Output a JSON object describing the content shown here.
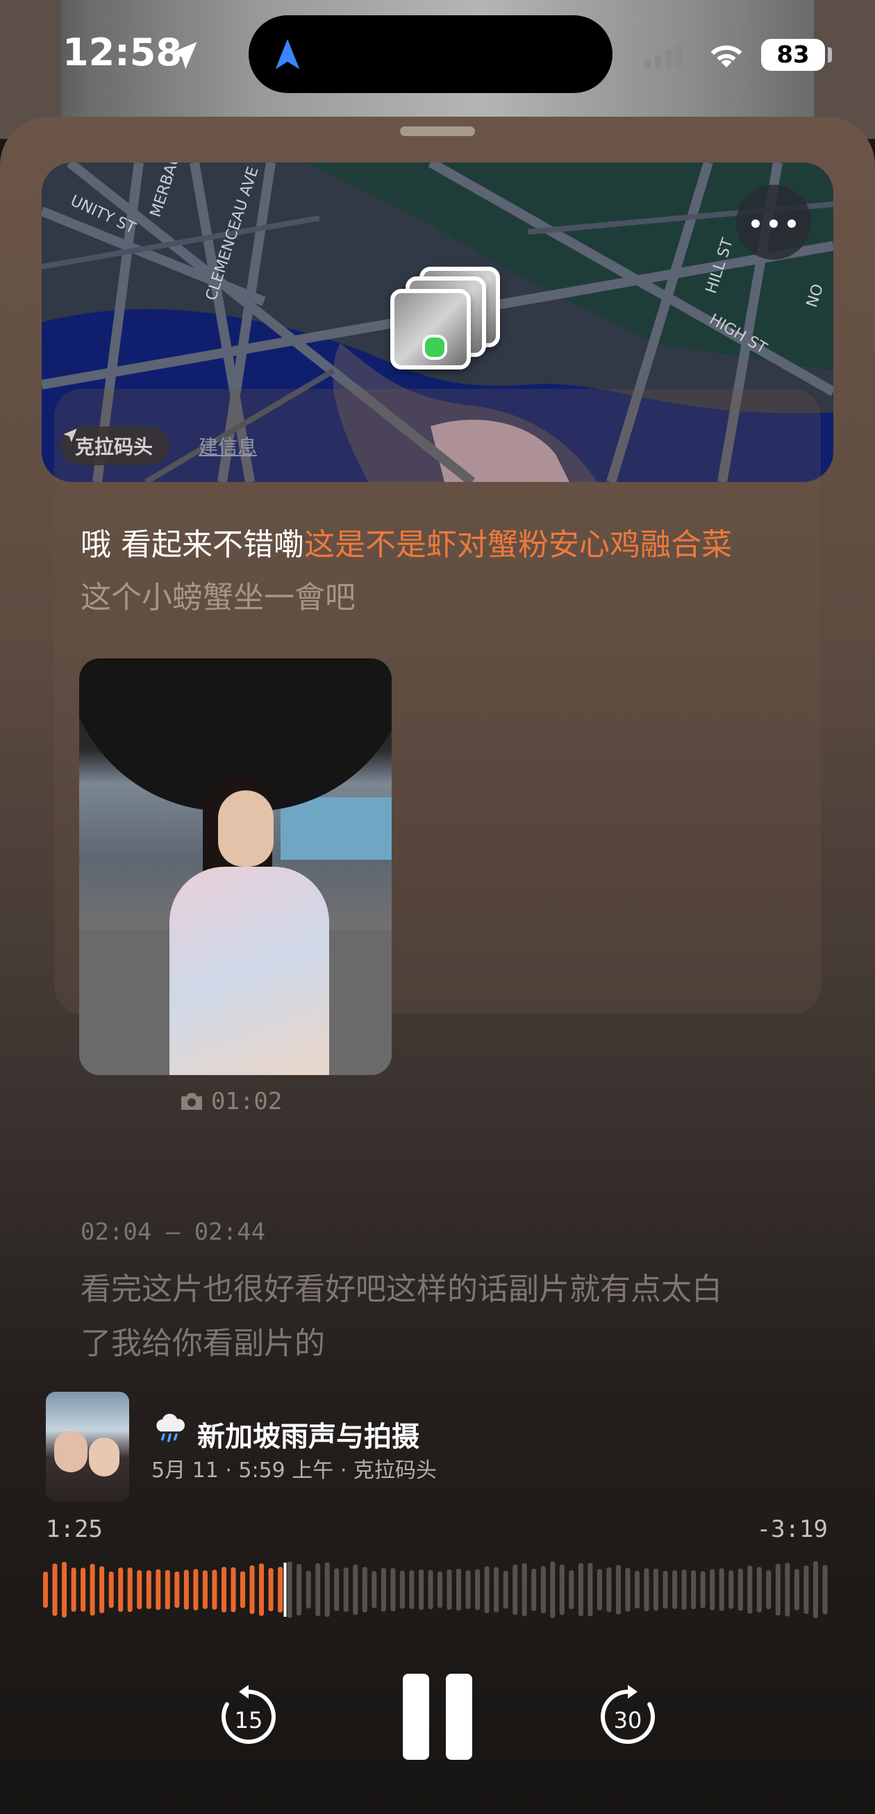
{
  "status_bar": {
    "time": "12:58",
    "battery": "83"
  },
  "map": {
    "location_label": "克拉码头",
    "sub_label": "建信息",
    "streets": [
      "UNITY ST",
      "MERBAU",
      "CLEMENCEAU AVE",
      "HILL ST",
      "HIGH ST",
      "NO"
    ],
    "cluster_dot_color": "#3ecf57"
  },
  "entry": {
    "caption_prefix": "哦 看起来不错嘞",
    "caption_highlight": "这是不是虾对蟹粉安心鸡融合菜",
    "caption_line2": "这个小螃蟹坐一會吧",
    "photo_time": "01:02",
    "highlight_color": "#ec7a3c"
  },
  "transcript": {
    "range": "02:04 – 02:44",
    "line1": "看完这片也很好看好吧这样的话副片就有点太白",
    "line2": "了我给你看副片的"
  },
  "now_playing": {
    "weather_icon": "cloud-rain-icon",
    "title": "新加坡雨声与拍摄",
    "subtitle": "5月 11 · 5:59 上午 · 克拉码头",
    "elapsed": "1:25",
    "remaining": "-3:19",
    "progress": 0.305,
    "played_color": "#e8682e",
    "unplayed_color": "#545250"
  },
  "controls": {
    "skip_back": "15",
    "skip_forward": "30"
  }
}
